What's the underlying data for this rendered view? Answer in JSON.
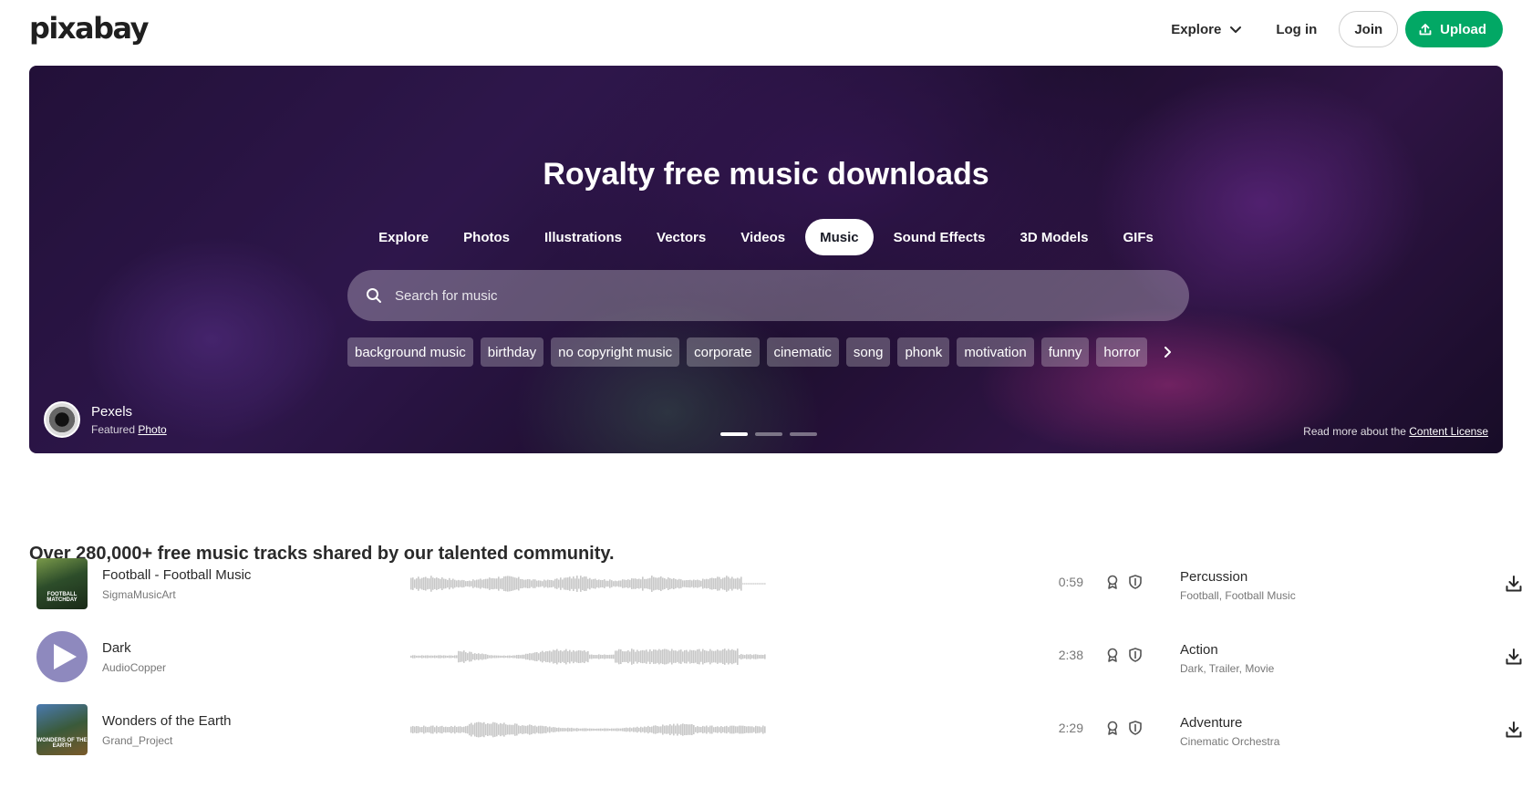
{
  "header": {
    "logo": "pixabay",
    "explore_label": "Explore",
    "login_label": "Log in",
    "join_label": "Join",
    "upload_label": "Upload"
  },
  "hero": {
    "title": "Royalty free music downloads",
    "tabs": [
      {
        "label": "Explore",
        "active": false
      },
      {
        "label": "Photos",
        "active": false
      },
      {
        "label": "Illustrations",
        "active": false
      },
      {
        "label": "Vectors",
        "active": false
      },
      {
        "label": "Videos",
        "active": false
      },
      {
        "label": "Music",
        "active": true
      },
      {
        "label": "Sound Effects",
        "active": false
      },
      {
        "label": "3D Models",
        "active": false
      },
      {
        "label": "GIFs",
        "active": false
      }
    ],
    "search_placeholder": "Search for music",
    "tags": [
      "background music",
      "birthday",
      "no copyright music",
      "corporate",
      "cinematic",
      "song",
      "phonk",
      "motivation",
      "funny",
      "horror"
    ],
    "credit": {
      "name": "Pexels",
      "featured_prefix": "Featured",
      "featured_link": "Photo"
    },
    "carousel_active_index": 0,
    "carousel_count": 3,
    "license_text": "Read more about the",
    "license_link": "Content License"
  },
  "tracks_section": {
    "title": "Over 280,000+ free music tracks shared by our talented community.",
    "tracks": [
      {
        "title": "Football - Football Music",
        "artist": "SigmaMusicArt",
        "duration": "0:59",
        "genre": "Percussion",
        "tags": "Football, Football Music",
        "cover": "FOOTBALL MATCHDAY"
      },
      {
        "title": "Dark",
        "artist": "AudioCopper",
        "duration": "2:38",
        "genre": "Action",
        "tags": "Dark, Trailer, Movie",
        "cover": ""
      },
      {
        "title": "Wonders of the Earth",
        "artist": "Grand_Project",
        "duration": "2:29",
        "genre": "Adventure",
        "tags": "Cinematic Orchestra",
        "cover": "WONDERS OF THE EARTH"
      }
    ]
  },
  "colors": {
    "accent": "#02a865",
    "hero_base": "#2a1545",
    "waveform": "#c8c8c8",
    "text_muted": "#777777"
  },
  "icons": {
    "explore_chevron": "chevron-down-icon",
    "upload": "upload-icon",
    "search": "search-icon",
    "tags_next": "chevron-right-icon",
    "badge1": "award-icon",
    "badge2": "shield-icon",
    "download": "download-icon",
    "play": "play-icon"
  }
}
